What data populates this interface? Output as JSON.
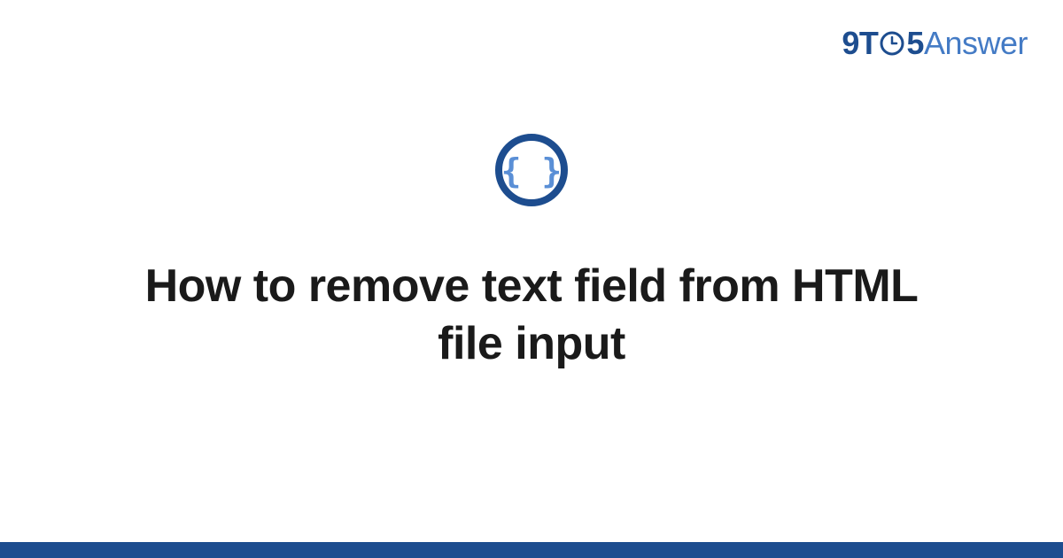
{
  "logo": {
    "part1": "9T",
    "part2": "5",
    "part3": "Answer"
  },
  "icon": {
    "name": "code-braces-icon"
  },
  "title": "How to remove text field from HTML file input",
  "colors": {
    "primary": "#1d4d8f",
    "accent": "#447bc5",
    "braces": "#5a8fd6"
  }
}
